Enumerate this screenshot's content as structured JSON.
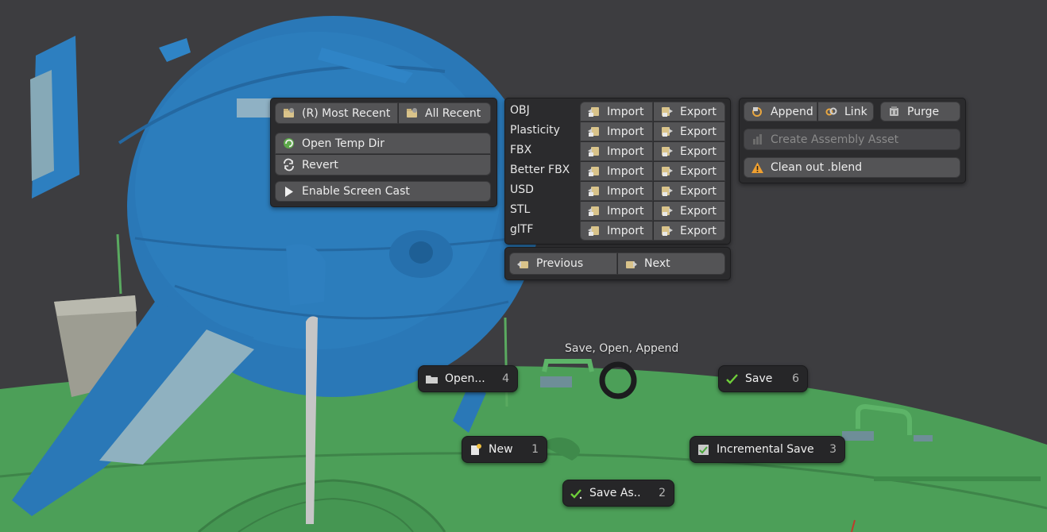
{
  "file_panel": {
    "most_recent": "(R) Most Recent",
    "all_recent": "All Recent",
    "open_temp_dir": "Open Temp Dir",
    "revert": "Revert",
    "screen_cast": "Enable Screen Cast"
  },
  "io_panel": {
    "import_label": "Import",
    "export_label": "Export",
    "formats": [
      "OBJ",
      "Plasticity",
      "FBX",
      "Better FBX",
      "USD",
      "STL",
      "glTF"
    ],
    "previous": "Previous",
    "next": "Next"
  },
  "asset_panel": {
    "append": "Append",
    "link": "Link",
    "purge": "Purge",
    "create_assembly": "Create Assembly Asset",
    "clean_out": "Clean out .blend"
  },
  "pie_menu": {
    "title": "Save, Open, Append",
    "open": {
      "label": "Open...",
      "key": "4"
    },
    "save": {
      "label": "Save",
      "key": "6"
    },
    "new": {
      "label": "New",
      "key": "1"
    },
    "incremental": {
      "label": "Incremental Save",
      "key": "3"
    },
    "save_as": {
      "label": "Save As..",
      "key": "2"
    }
  },
  "colors": {
    "hull_blue": "#2b79b8",
    "ground_green": "#4a9e58",
    "viewport_bg": "#3d3d40",
    "accent_check": "#6fcf3a"
  }
}
